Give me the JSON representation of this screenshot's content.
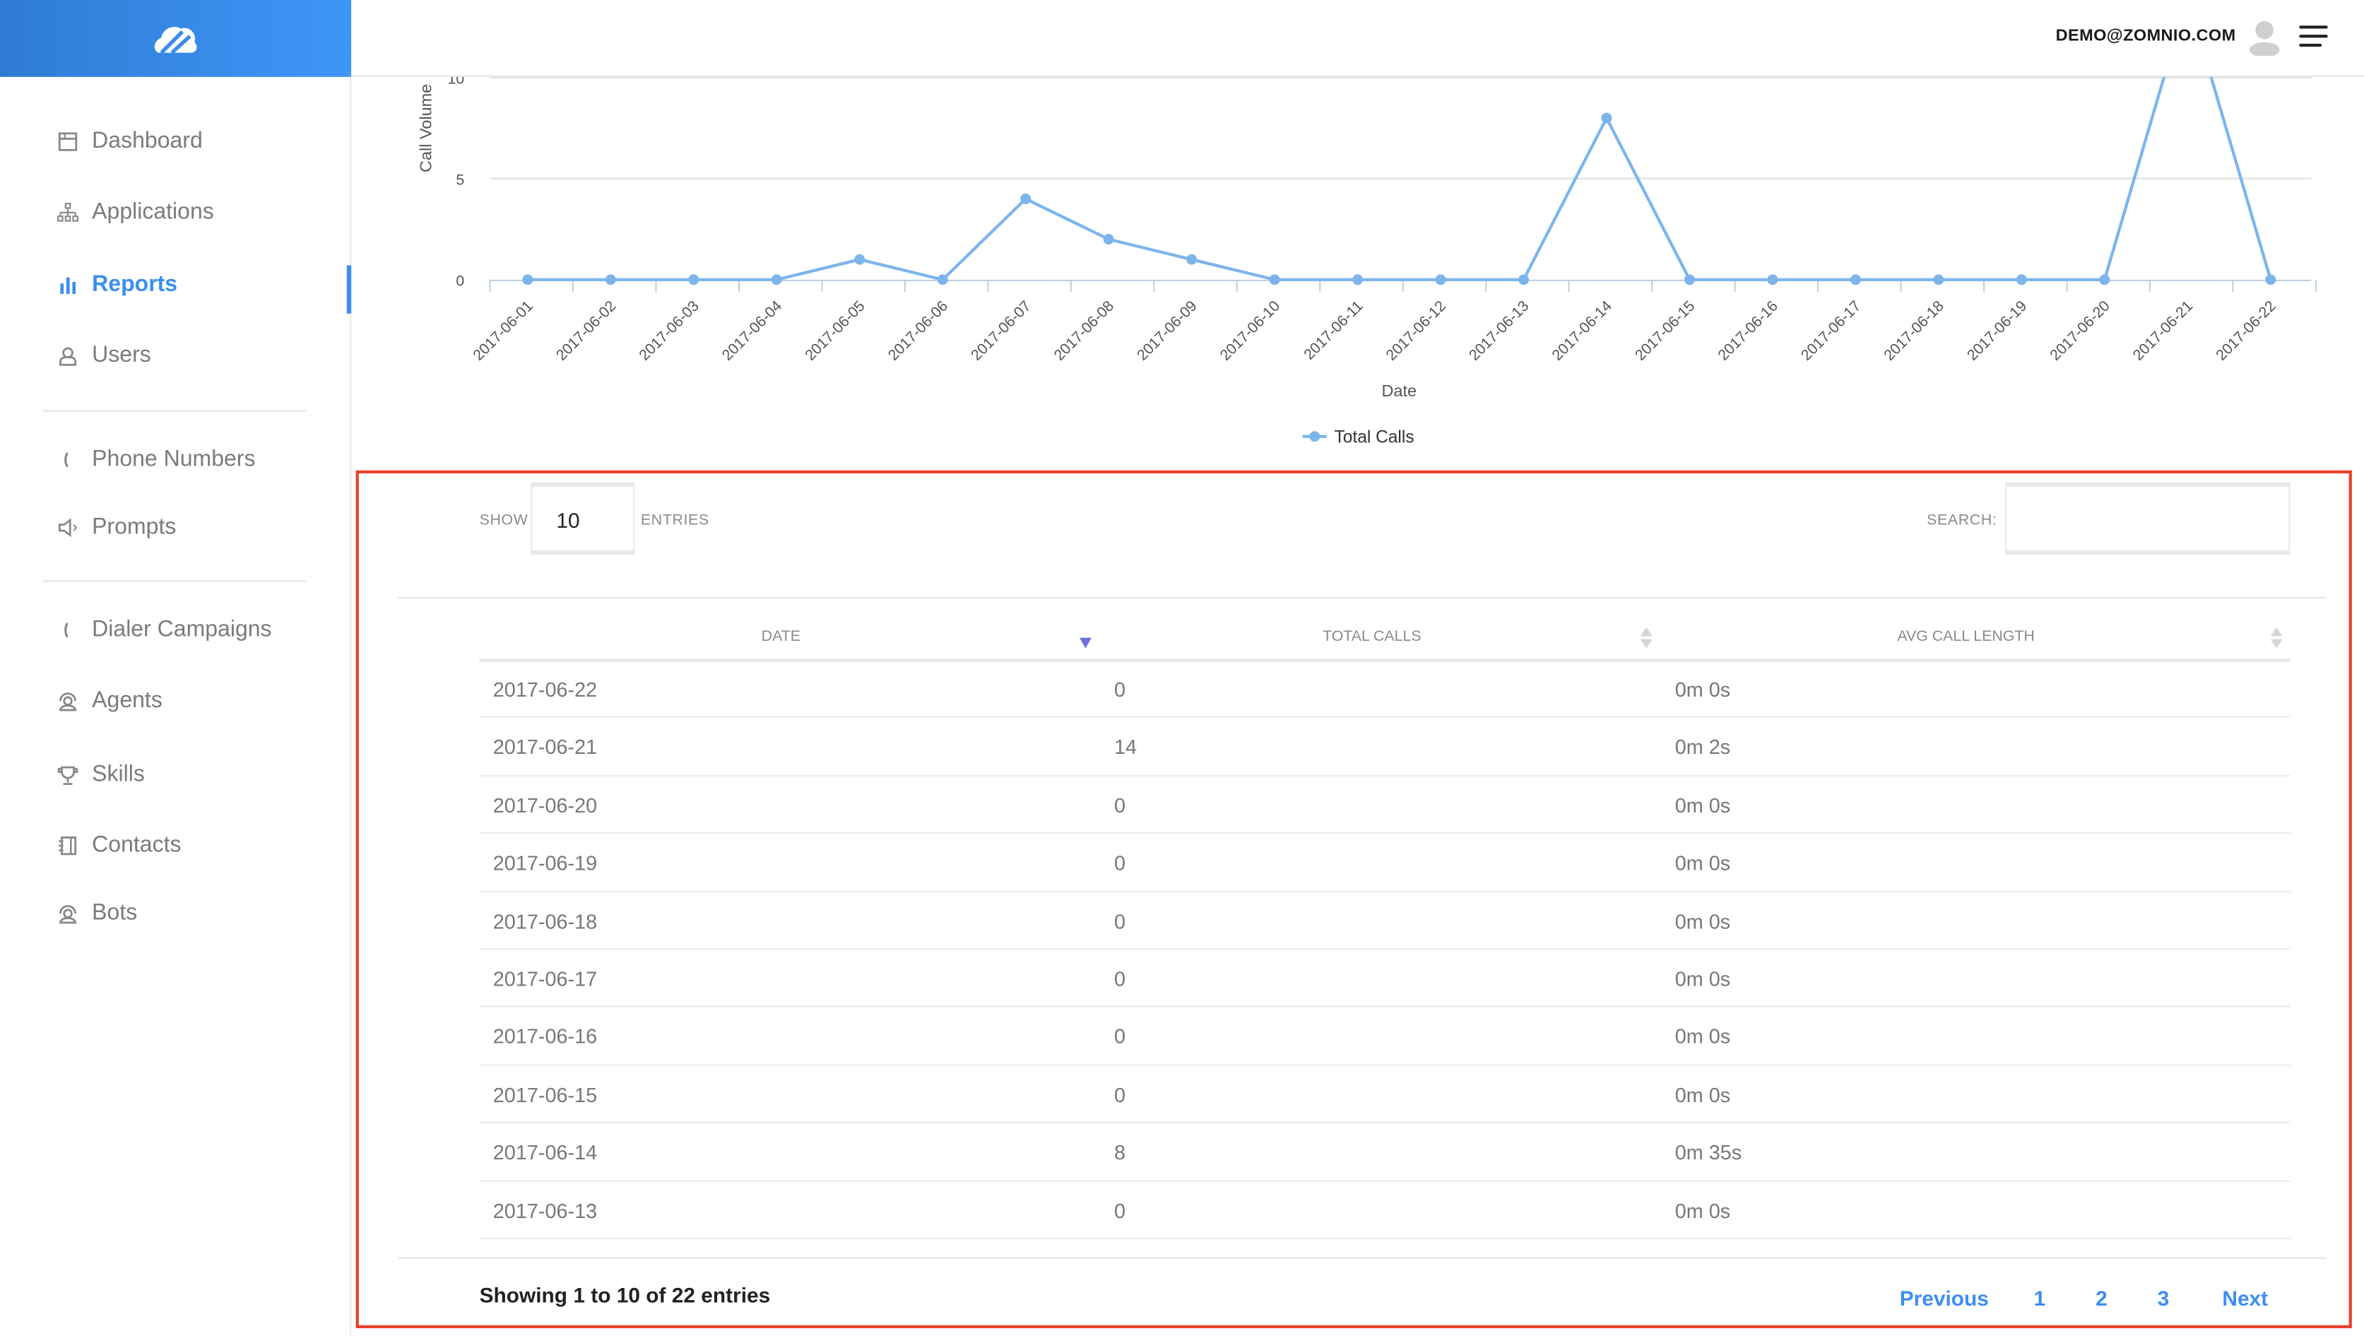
{
  "header": {
    "user_email": "DEMO@ZOMNIO.COM",
    "icons": [
      "logo-icon",
      "avatar-icon",
      "hamburger-menu-icon"
    ]
  },
  "sidebar": {
    "items": [
      {
        "label": "Dashboard",
        "icon": "dashboard-icon",
        "active": false
      },
      {
        "label": "Applications",
        "icon": "sitemap-icon",
        "active": false
      },
      {
        "label": "Reports",
        "icon": "bar-chart-icon",
        "active": true
      },
      {
        "label": "Users",
        "icon": "user-icon",
        "active": false
      },
      {
        "label": "Phone Numbers",
        "icon": "phone-icon",
        "active": false
      },
      {
        "label": "Prompts",
        "icon": "speaker-icon",
        "active": false
      },
      {
        "label": "Dialer Campaigns",
        "icon": "phone-icon",
        "active": false
      },
      {
        "label": "Agents",
        "icon": "headset-user-icon",
        "active": false
      },
      {
        "label": "Skills",
        "icon": "trophy-icon",
        "active": false
      },
      {
        "label": "Contacts",
        "icon": "address-book-icon",
        "active": false
      },
      {
        "label": "Bots",
        "icon": "headset-user-icon",
        "active": false
      }
    ],
    "accent": "#3d8ef0"
  },
  "chart_data": {
    "type": "line",
    "xlabel": "Date",
    "ylabel": "Call Volume",
    "y_ticks": [
      "0",
      "5",
      "10"
    ],
    "ylim": [
      0,
      10
    ],
    "grid": true,
    "legend_position": "bottom",
    "categories": [
      "2017-06-01",
      "2017-06-02",
      "2017-06-03",
      "2017-06-04",
      "2017-06-05",
      "2017-06-06",
      "2017-06-07",
      "2017-06-08",
      "2017-06-09",
      "2017-06-10",
      "2017-06-11",
      "2017-06-12",
      "2017-06-13",
      "2017-06-14",
      "2017-06-15",
      "2017-06-16",
      "2017-06-17",
      "2017-06-18",
      "2017-06-19",
      "2017-06-20",
      "2017-06-21",
      "2017-06-22"
    ],
    "series": [
      {
        "name": "Total Calls",
        "color": "#7cb5ec",
        "values": [
          0,
          0,
          0,
          0,
          1,
          0,
          4,
          2,
          1,
          0,
          0,
          0,
          0,
          8,
          0,
          0,
          0,
          0,
          0,
          0,
          14,
          0
        ]
      }
    ]
  },
  "table_controls": {
    "show_label": "SHOW",
    "entries_value": "10",
    "entries_label": "ENTRIES",
    "search_label": "SEARCH:",
    "search_value": ""
  },
  "table": {
    "columns": [
      "DATE",
      "TOTAL CALLS",
      "AVG CALL LENGTH"
    ],
    "sort": {
      "column": "DATE",
      "direction": "descending"
    },
    "rows": [
      [
        "2017-06-22",
        "0",
        "0m 0s"
      ],
      [
        "2017-06-21",
        "14",
        "0m 2s"
      ],
      [
        "2017-06-20",
        "0",
        "0m 0s"
      ],
      [
        "2017-06-19",
        "0",
        "0m 0s"
      ],
      [
        "2017-06-18",
        "0",
        "0m 0s"
      ],
      [
        "2017-06-17",
        "0",
        "0m 0s"
      ],
      [
        "2017-06-16",
        "0",
        "0m 0s"
      ],
      [
        "2017-06-15",
        "0",
        "0m 0s"
      ],
      [
        "2017-06-14",
        "8",
        "0m 35s"
      ],
      [
        "2017-06-13",
        "0",
        "0m 0s"
      ]
    ]
  },
  "footer": {
    "info": "Showing 1 to 10 of 22 entries",
    "pagination": {
      "previous": "Previous",
      "pages": [
        "1",
        "2",
        "3"
      ],
      "next": "Next"
    }
  },
  "highlight_color": "#e8432b"
}
